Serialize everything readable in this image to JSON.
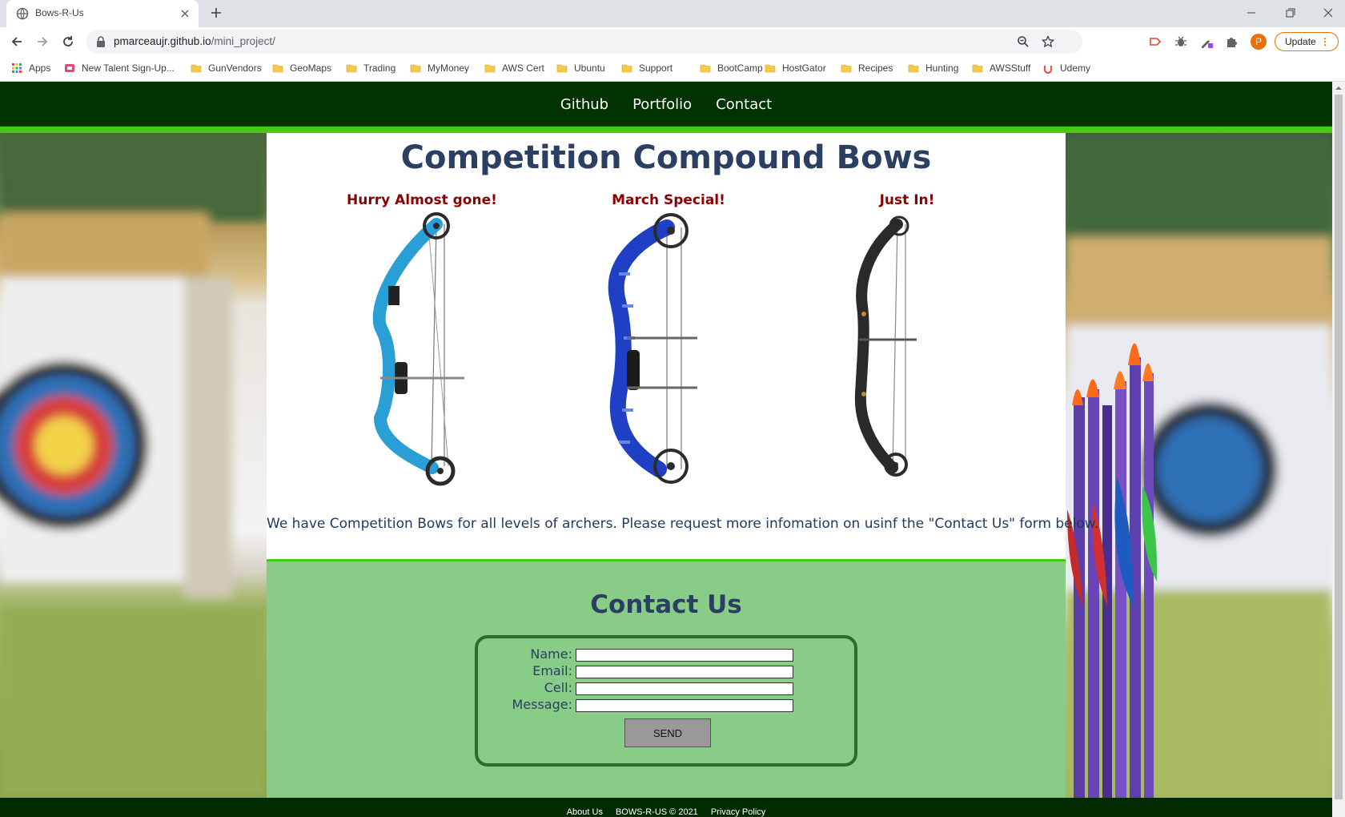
{
  "browser": {
    "tab_title": "Bows-R-Us",
    "url_host": "pmarceaujr.github.io",
    "url_path": "/mini_project/",
    "profile_initial": "P",
    "update_label": "Update",
    "icons": {
      "favicon": "globe-icon",
      "close": "close-icon",
      "new_tab": "plus-icon",
      "back": "back-arrow-icon",
      "forward": "forward-arrow-icon",
      "reload": "reload-icon",
      "lock": "lock-icon",
      "zoom": "zoom-icon",
      "star": "star-icon",
      "extensions": "puzzle-icon"
    }
  },
  "bookmarks": [
    {
      "label": "Apps",
      "icon": "apps-grid-icon"
    },
    {
      "label": "New Talent Sign-Up...",
      "icon": "site-icon"
    },
    {
      "label": "GunVendors",
      "icon": "folder-icon"
    },
    {
      "label": "GeoMaps",
      "icon": "folder-icon"
    },
    {
      "label": "Trading",
      "icon": "folder-icon"
    },
    {
      "label": "MyMoney",
      "icon": "folder-icon"
    },
    {
      "label": "AWS Cert",
      "icon": "folder-icon"
    },
    {
      "label": "Ubuntu",
      "icon": "folder-icon"
    },
    {
      "label": "Support",
      "icon": "folder-icon"
    },
    {
      "label": "BootCamp",
      "icon": "folder-icon"
    },
    {
      "label": "HostGator",
      "icon": "folder-icon"
    },
    {
      "label": "Recipes",
      "icon": "folder-icon"
    },
    {
      "label": "Hunting",
      "icon": "folder-icon"
    },
    {
      "label": "AWSStuff",
      "icon": "folder-icon"
    },
    {
      "label": "Udemy",
      "icon": "udemy-icon"
    }
  ],
  "site": {
    "nav": [
      "Github",
      "Portfolio",
      "Contact"
    ],
    "heading": "Competition Compound Bows",
    "bows": [
      {
        "caption": "Hurry Almost gone!",
        "color": "#2a9fd6"
      },
      {
        "caption": "March Special!",
        "color": "#1f3fc4"
      },
      {
        "caption": "Just In!",
        "color": "#2a2a2a"
      }
    ],
    "promo": "We have Competition Bows for all levels of archers. Please request more infomation on usinf the \"Contact Us\" form below.",
    "contact": {
      "heading": "Contact Us",
      "fields": [
        {
          "label": "Name:",
          "value": ""
        },
        {
          "label": "Email:",
          "value": ""
        },
        {
          "label": "Cell:",
          "value": ""
        },
        {
          "label": "Message:",
          "value": ""
        }
      ],
      "send_label": "SEND"
    },
    "footer": [
      "About Us",
      "BOWS-R-US © 2021",
      "Privacy Policy"
    ]
  },
  "colors": {
    "nav_bg": "#003300",
    "accent_green": "#44cc11",
    "contact_bg": "#88cc88",
    "heading_blue": "#2b3f63",
    "caption_red": "#8b0000"
  }
}
